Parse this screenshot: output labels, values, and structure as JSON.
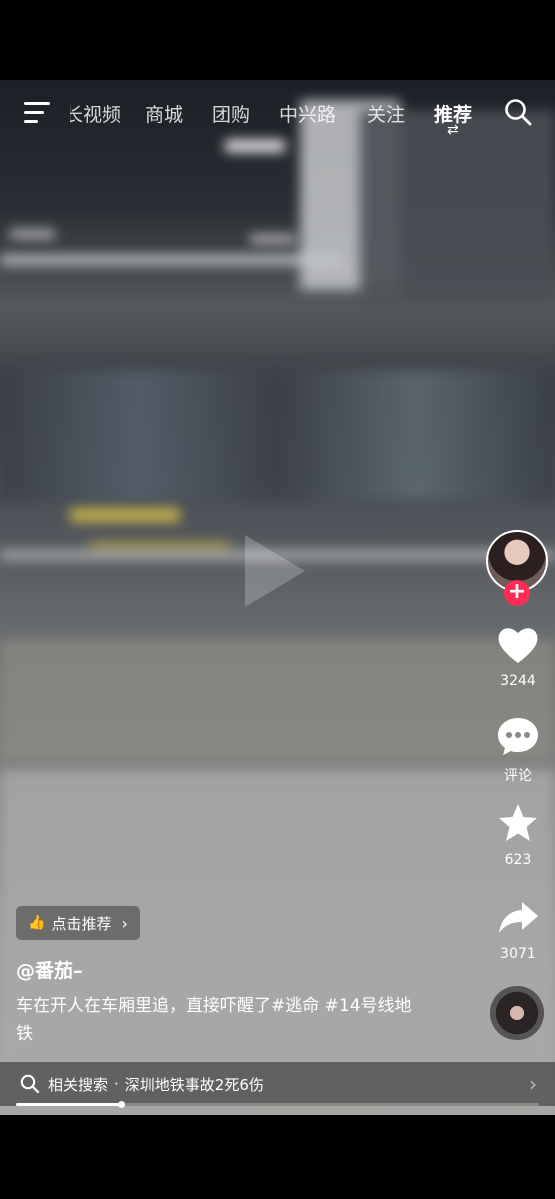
{
  "nav": {
    "tabs": [
      "长视频",
      "商城",
      "团购",
      "中兴路",
      "关注",
      "推荐"
    ],
    "active_tab": "推荐"
  },
  "sidebar": {
    "likes": "3244",
    "comments_label": "评论",
    "favorites": "623",
    "shares": "3071"
  },
  "recommend_chip": "点击推荐",
  "author": "@番茄–",
  "description": "车在开人在车厢里追，直接吓醒了#逃命 #14号线地铁",
  "related_search": {
    "label": "相关搜索",
    "separator": "·",
    "query": "深圳地铁事故2死6伤"
  },
  "progress": 0.2
}
